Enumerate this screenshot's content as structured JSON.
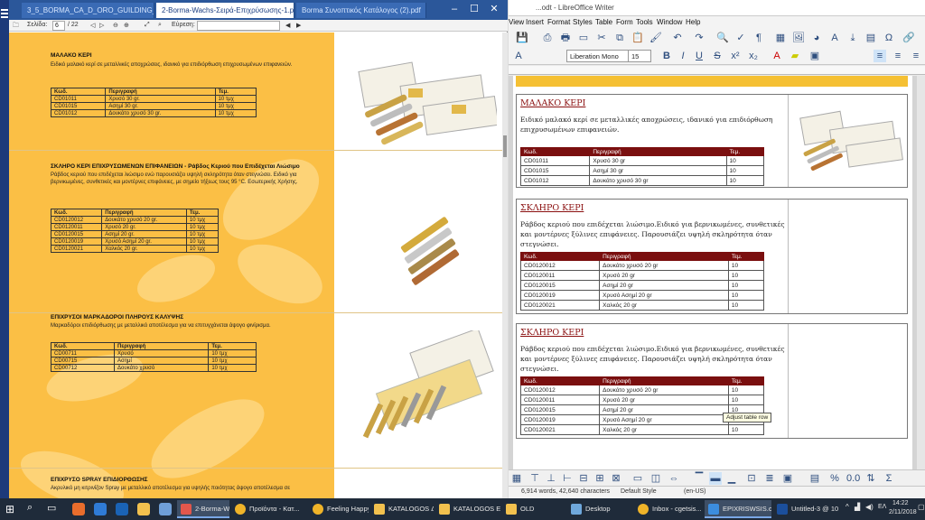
{
  "pdf_viewer": {
    "tabs": [
      {
        "label": "3_5_BORMA_CA_D_ORO_GUILDING_LINE.pdf",
        "active": false
      },
      {
        "label": "2-Borma-Wachs-Σειρά-Επιχρύσωσης-1.pdf",
        "active": true
      },
      {
        "label": "Borma Συνοπτικός Κατάλογος (2).pdf",
        "active": false
      }
    ],
    "toolbar": {
      "page_label": "Σελίδα:",
      "page_current": "6",
      "page_total": "/ 22",
      "search_label": "Εύρεση:"
    },
    "sections": [
      {
        "title": "ΜΑΛΑΚΟ ΚΕΡΙ",
        "desc": "Ειδικό μαλακό κερί σε μεταλλικές αποχρώσεις, ιδανικό για επιδιόρθωση επιχρυσωμένων επιφανειών.",
        "headers": [
          "Κωδ.",
          "Περιγραφή",
          "Τεμ."
        ],
        "rows": [
          [
            "CD01011",
            "Χρυσό 30 gr.",
            "10 τμχ"
          ],
          [
            "CD01015",
            "Ασημί 30 gr.",
            "10 τμχ"
          ],
          [
            "CD01012",
            "Δουκάτο χρυσό 30 gr.",
            "10 τμχ"
          ]
        ]
      },
      {
        "title": "ΣΚΛΗΡΟ ΚΕΡΙ ΕΠΙΧΡΥΣΩΜΕΝΩΝ ΕΠΙΦΑΝΕΙΩΝ - Ράβδος Κεριού που Επιδέχεται Λιώσιμο",
        "desc": "Ράβδος κεριού που επιδέχεται λιώσιμο ενώ παρουσιάζει υψηλή σκληρότητα όταν στεγνώσει. Ειδικό για βερνικωμένες, συνθετικές και μοντέρνες επιφάνειες, με σημείο τήξεως τους 95 °C. Εσωτερικής Χρήσης.",
        "headers": [
          "Κωδ.",
          "Περιγραφή",
          "Τεμ."
        ],
        "rows": [
          [
            "CD0120012",
            "Δουκάτο χρυσό 20 gr.",
            "10 τμχ"
          ],
          [
            "CD0120011",
            "Χρυσό 20 gr.",
            "10 τμχ"
          ],
          [
            "CD0120015",
            "Ασημί 20 gr.",
            "10 τμχ"
          ],
          [
            "CD0120019",
            "Χρυσό Ασημί 20 gr.",
            "10 τμχ"
          ],
          [
            "CD0120021",
            "Χαλκός 20 gr.",
            "10 τμχ"
          ]
        ]
      },
      {
        "title": "ΕΠΙΧΡΥΣΟΙ ΜΑΡΚΑΔΟΡΟΙ ΠΛΗΡΟΥΣ ΚΑΛΥΨΗΣ",
        "desc": "Μαρκαδόροι επιδιόρθωσης με μεταλλικό αποτέλεσμα για να επιτυγχάνεται άψογο φινίρισμα.",
        "headers": [
          "Κωδ.",
          "Περιγραφή",
          "Τεμ."
        ],
        "rows": [
          [
            "CD00711",
            "Χρυσό",
            "10 τμχ"
          ],
          [
            "CD00715",
            "Ασημί",
            "10 τμχ"
          ],
          [
            "CD00712",
            "Δουκάτο χρυσό",
            "10 τμχ"
          ]
        ]
      },
      {
        "title": "ΕΠΙΧΡΥΣΟ SPRAY ΕΠΙΔΙΟΡΘΩΣΗΣ",
        "desc": "Ακρυλικό μη κιτρινίζον Spray με μεταλλικό αποτέλεσμα για υψηλής ποιότητας άψογο αποτέλεσμα σε"
      }
    ]
  },
  "writer": {
    "title": "...odt - LibreOffice Writer",
    "menu": [
      "View",
      "Insert",
      "Format",
      "Styles",
      "Table",
      "Form",
      "Tools",
      "Window",
      "Help"
    ],
    "font_name": "Liberation Mono",
    "font_size": "15",
    "sections": [
      {
        "heading": "ΜΑΛΑΚΟ ΚΕΡΙ",
        "text": "Ειδικό μαλακό κερί σε μεταλλικές αποχρώσεις, ιδανικό για επιδιόρθωση επιχρυσωμένων επιφανειών.",
        "headers": [
          "Κωδ.",
          "Περιγραφή",
          "Τεμ."
        ],
        "rows": [
          [
            "CD01011",
            "Χρυσό 30 gr",
            "10"
          ],
          [
            "CD01015",
            "Ασημί 30 gr",
            "10"
          ],
          [
            "CD01012",
            "Δουκάτο χρυσό 30 gr",
            "10"
          ]
        ]
      },
      {
        "heading": "ΣΚΛΗΡΟ ΚΕΡΙ",
        "text": "Ράβδος κεριού που επιδέχεται λιώσιμο.Ειδικό για βερνικωμένες, συνθετικές και μοντέρνες ξύλινες επιφάνειες. Παρουσιάζει υψηλή σκληρότητα όταν στεγνώσει.",
        "headers": [
          "Κωδ.",
          "Περιγραφή",
          "Τεμ."
        ],
        "rows": [
          [
            "CD0120012",
            "Δουκάτο χρυσό 20 gr",
            "10"
          ],
          [
            "CD0120011",
            "Χρυσό 20 gr",
            "10"
          ],
          [
            "CD0120015",
            "Ασημί 20 gr",
            "10"
          ],
          [
            "CD0120019",
            "Χρυσό Ασημί 20 gr",
            "10"
          ],
          [
            "CD0120021",
            "Χαλκός 20 gr",
            "10"
          ]
        ]
      },
      {
        "heading": "ΣΚΛΗΡΟ ΚΕΡΙ",
        "text": "Ράβδος κεριού που επιδέχεται λιώσιμο.Ειδικό για βερνικωμένες, συνθετικές και μοντέρνες ξύλινες επιφάνειες. Παρουσιάζει υψηλή σκληρότητα όταν στεγνώσει.",
        "headers": [
          "Κωδ.",
          "Περιγραφή",
          "Τεμ."
        ],
        "rows": [
          [
            "CD0120012",
            "Δουκάτο χρυσό 20 gr",
            "10"
          ],
          [
            "CD0120011",
            "Χρυσό 20 gr",
            "10"
          ],
          [
            "CD0120015",
            "Ασημί 20 gr",
            "10"
          ],
          [
            "CD0120019",
            "Χρυσό Ασημί 20 gr",
            "10"
          ],
          [
            "CD0120021",
            "Χαλκός 20 gr",
            "10"
          ]
        ]
      }
    ],
    "tooltip": "Adjust table row",
    "status": {
      "words": "6,914 words, 42,640 characters",
      "page_style": "Default Style",
      "language": "(en-US)"
    }
  },
  "taskbar": {
    "items": [
      {
        "label": "2-Borma-Wach...",
        "color": "#e2574c",
        "active": true
      },
      {
        "label": "Προϊόντα - Κατ...",
        "color": "#f0b429",
        "active": false
      },
      {
        "label": "Feeling Happy -...",
        "color": "#f0b429",
        "active": false
      },
      {
        "label": "KATALOGOS Δ...",
        "color": "#f2c14e",
        "active": false
      },
      {
        "label": "KATALOGOS ES...",
        "color": "#f2c14e",
        "active": false
      },
      {
        "label": "OLD",
        "color": "#f2c14e",
        "active": false
      },
      {
        "label": "Desktop",
        "color": "#6fa8dc",
        "active": false
      },
      {
        "label": "Inbox - cgetsis...",
        "color": "#f0b429",
        "active": false
      },
      {
        "label": "EPIXRISWSIS.od...",
        "color": "#3c8dde",
        "active": false
      },
      {
        "label": "Untitled-3 @ 10...",
        "color": "#1b4f9c",
        "active": false
      }
    ],
    "lang": "ΕΛ",
    "time": "14:22",
    "date": "2/11/2018"
  }
}
